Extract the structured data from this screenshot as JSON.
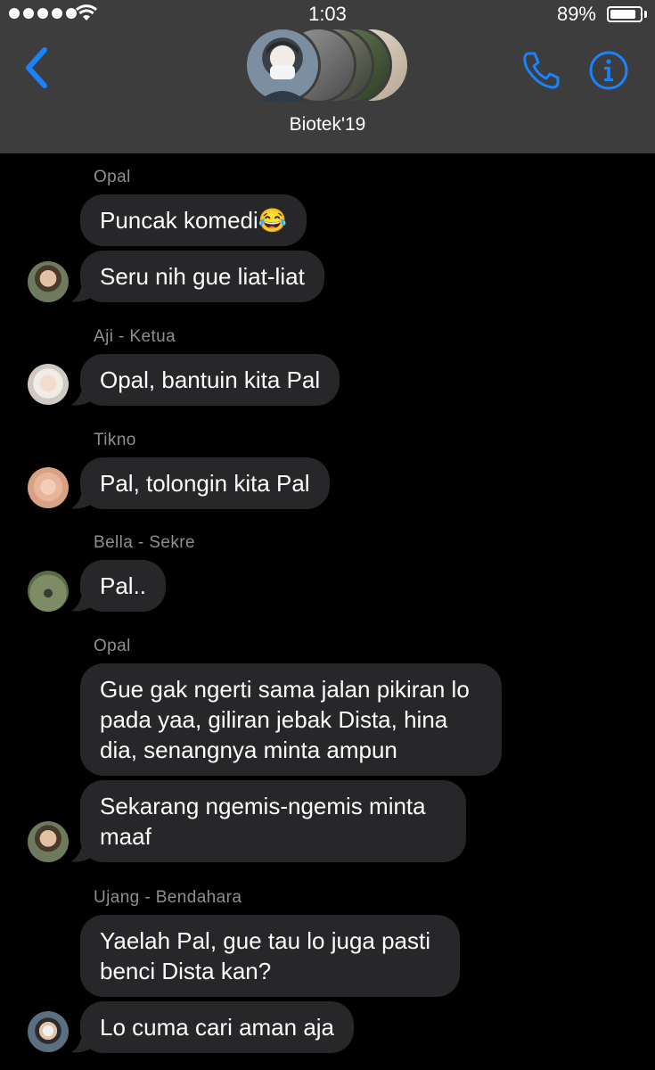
{
  "status_bar": {
    "time": "1:03",
    "battery_percent": "89%",
    "battery_level": 0.89,
    "signal_dots": 5
  },
  "header": {
    "group_name": "Biotek'19",
    "accent_color": "#1a82fb",
    "icons": [
      "back-chevron-icon",
      "phone-icon",
      "info-icon"
    ]
  },
  "messages": [
    {
      "sender": "Opal",
      "text": "Puncak komedi😂"
    },
    {
      "sender": "",
      "text": "Seru nih gue liat-liat"
    },
    {
      "sender": "Aji - Ketua",
      "text": "Opal, bantuin kita Pal"
    },
    {
      "sender": "Tikno",
      "text": "Pal, tolongin kita Pal"
    },
    {
      "sender": "Bella - Sekre",
      "text": "Pal.."
    },
    {
      "sender": "Opal",
      "text": "Gue gak ngerti sama jalan pikiran lo pada yaa, giliran jebak Dista, hina dia, senangnya minta ampun"
    },
    {
      "sender": "",
      "text": "Sekarang ngemis-ngemis minta maaf"
    },
    {
      "sender": "Ujang - Bendahara",
      "text": "Yaelah Pal, gue tau lo juga pasti benci Dista kan?"
    },
    {
      "sender": "",
      "text": "Lo cuma cari aman aja"
    }
  ],
  "colors": {
    "background": "#000000",
    "header": "#3d3d3d",
    "bubble": "#27272a",
    "sender_name": "#8e8e93"
  }
}
